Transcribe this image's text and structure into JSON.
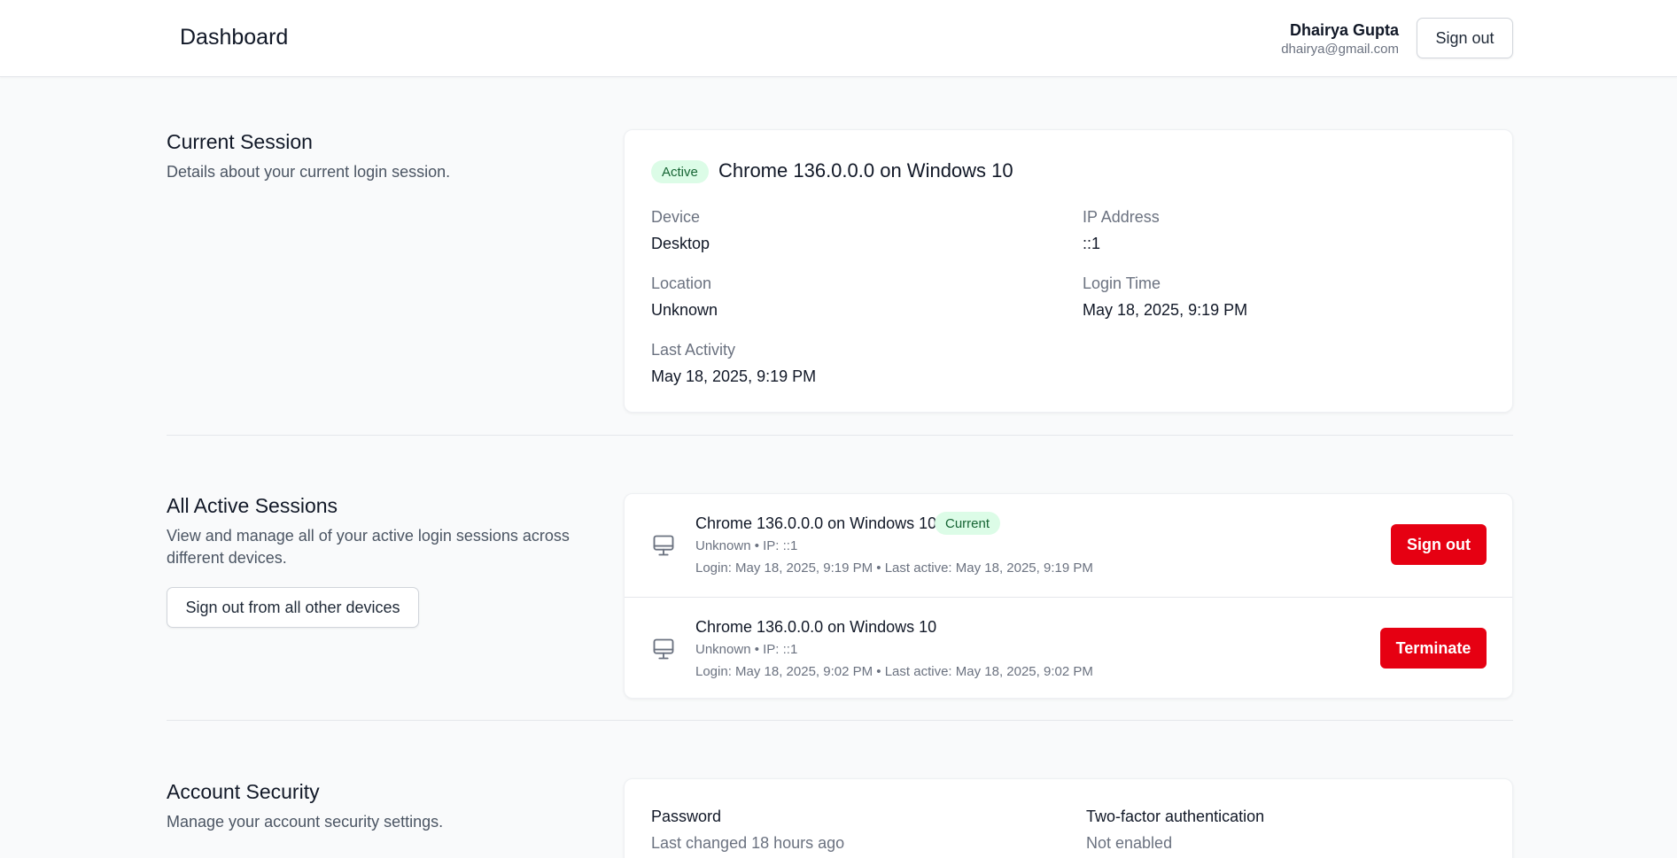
{
  "header": {
    "title": "Dashboard",
    "user_name": "Dhairya Gupta",
    "user_email": "dhairya@gmail.com",
    "sign_out_label": "Sign out"
  },
  "current_session": {
    "title": "Current Session",
    "description": "Details about your current login session.",
    "status_badge": "Active",
    "session_name": "Chrome 136.0.0.0 on Windows 10",
    "fields": {
      "device_label": "Device",
      "device_value": "Desktop",
      "ip_label": "IP Address",
      "ip_value": "::1",
      "location_label": "Location",
      "location_value": "Unknown",
      "login_time_label": "Login Time",
      "login_time_value": "May 18, 2025, 9:19 PM",
      "last_activity_label": "Last Activity",
      "last_activity_value": "May 18, 2025, 9:19 PM"
    }
  },
  "active_sessions": {
    "title": "All Active Sessions",
    "description": "View and manage all of your active login sessions across different devices.",
    "sign_out_all_label": "Sign out from all other devices",
    "items": [
      {
        "name": "Chrome 136.0.0.0 on Windows 10",
        "badge": "Current",
        "location_ip": "Unknown • IP: ::1",
        "times": "Login: May 18, 2025, 9:19 PM • Last active: May 18, 2025, 9:19 PM",
        "action_label": "Sign out",
        "icon": "monitor-icon"
      },
      {
        "name": "Chrome 136.0.0.0 on Windows 10",
        "location_ip": "Unknown • IP: ::1",
        "times": "Login: May 18, 2025, 9:02 PM • Last active: May 18, 2025, 9:02 PM",
        "action_label": "Terminate",
        "icon": "monitor-icon"
      }
    ]
  },
  "account_security": {
    "title": "Account Security",
    "description": "Manage your account security settings.",
    "password_label": "Password",
    "password_value": "Last changed 18 hours ago",
    "two_factor_label": "Two-factor authentication",
    "two_factor_value": "Not enabled"
  },
  "colors": {
    "accent_red": "#e60012",
    "badge_green_bg": "#dcfce7",
    "badge_green_text": "#166534",
    "page_bg": "#f9fafb"
  }
}
